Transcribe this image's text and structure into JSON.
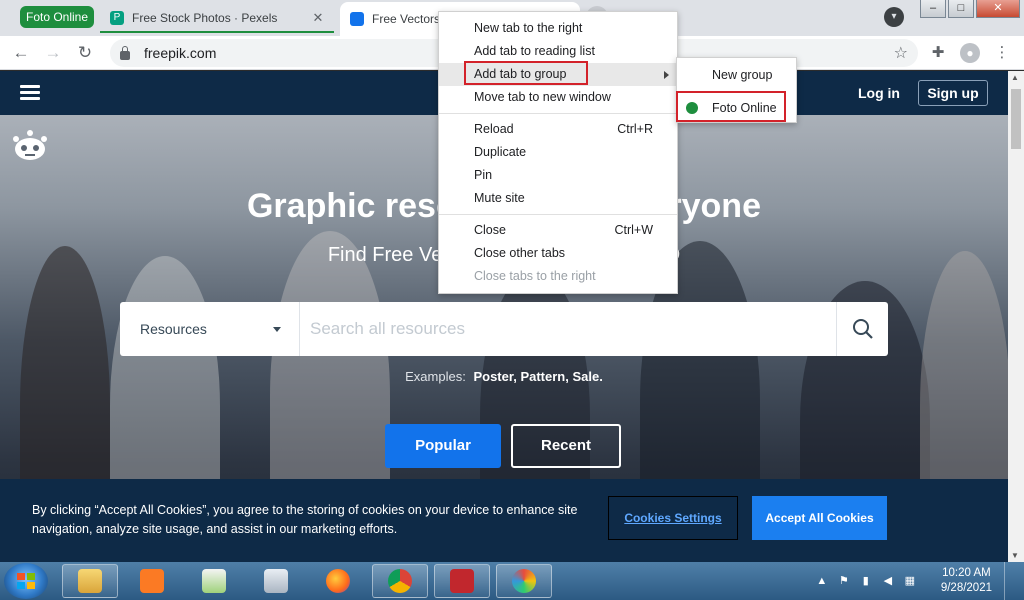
{
  "browser": {
    "group_chip": "Foto Online",
    "tabs": [
      {
        "title": "Free Stock Photos · Pexels",
        "favicon": "pexels-favicon",
        "favicon_letter": "P"
      },
      {
        "title": "Free Vectors",
        "favicon": "freepik-favicon"
      }
    ],
    "tab_close_glyph": "✕",
    "url": "freepik.com",
    "window_controls": {
      "minimize": "–",
      "maximize": "□",
      "close": "✕"
    }
  },
  "context_menu": {
    "items": [
      {
        "label": "New tab to the right",
        "shortcut": ""
      },
      {
        "label": "Add tab to reading list",
        "shortcut": ""
      },
      {
        "label": "Add tab to group",
        "shortcut": "",
        "submenu": true,
        "highlighted": true
      },
      {
        "label": "Move tab to new window",
        "shortcut": ""
      },
      {
        "label": "Reload",
        "shortcut": "Ctrl+R"
      },
      {
        "label": "Duplicate",
        "shortcut": ""
      },
      {
        "label": "Pin",
        "shortcut": ""
      },
      {
        "label": "Mute site",
        "shortcut": ""
      },
      {
        "label": "Close",
        "shortcut": "Ctrl+W"
      },
      {
        "label": "Close other tabs",
        "shortcut": ""
      },
      {
        "label": "Close tabs to the right",
        "shortcut": "",
        "disabled": true
      }
    ],
    "submenu": {
      "new_group": "New group",
      "existing_group": "Foto Online",
      "existing_group_color": "#1e8e3e"
    }
  },
  "page": {
    "header": {
      "login": "Log in",
      "signup": "Sign up"
    },
    "hero_title": "Graphic resources for everyone",
    "hero_subtitle": "Find Free Vectors, Stock Photos & PSD",
    "search": {
      "category": "Resources",
      "placeholder": "Search all resources"
    },
    "examples_label": "Examples:",
    "examples": [
      "Poster",
      "Pattern",
      "Sale"
    ],
    "btn_popular": "Popular",
    "btn_recent": "Recent",
    "cookie": {
      "text": "By clicking “Accept All Cookies”, you agree to the storing of cookies on your device to enhance site navigation, analyze site usage, and assist in our marketing efforts.",
      "settings": "Cookies Settings",
      "accept": "Accept All Cookies"
    }
  },
  "taskbar": {
    "apps": [
      "file-explorer-icon",
      "xampp-icon",
      "notepad-plus-icon",
      "calculator-icon",
      "firefox-icon",
      "chrome-icon",
      "filezilla-icon",
      "paint-icon"
    ],
    "time": "10:20 AM",
    "date": "9/28/2021"
  },
  "colors": {
    "freepik_navy": "#0e2a47",
    "freepik_blue": "#1273eb",
    "group_green": "#1e8e3e",
    "highlight_red": "#d3222a"
  }
}
